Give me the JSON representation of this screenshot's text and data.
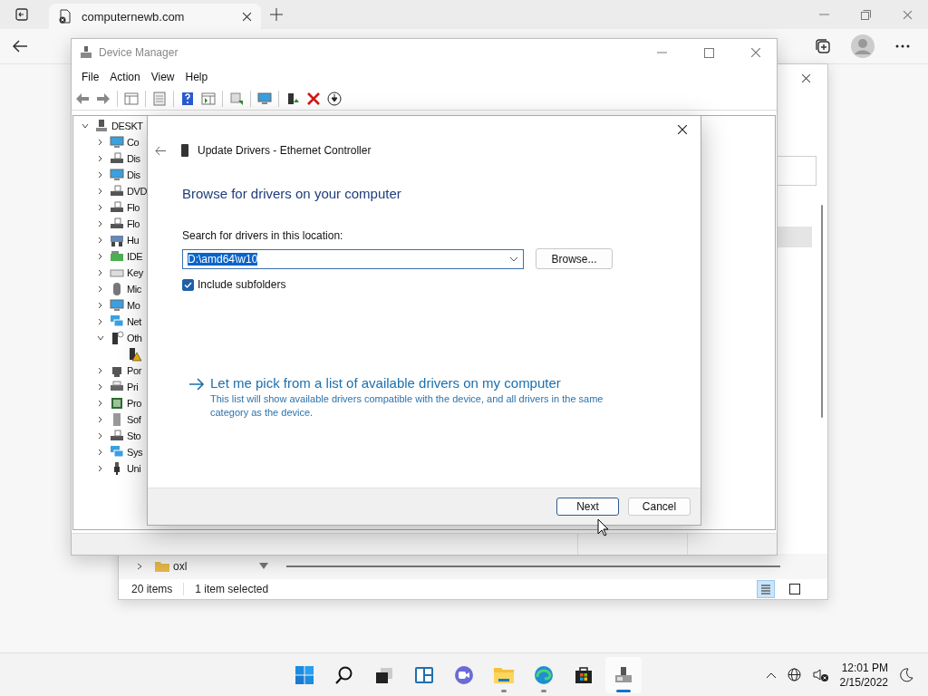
{
  "browser": {
    "tab": {
      "title": "computernewb.com"
    }
  },
  "background_window": {
    "nav_item": {
      "label": "oxl",
      "expanded": false
    },
    "status_bar": {
      "item_count": "20 items",
      "selection": "1 item selected"
    },
    "views": [
      {
        "kind": "details",
        "selected": true
      },
      {
        "kind": "tiles",
        "selected": false
      }
    ]
  },
  "device_manager": {
    "title": "Device Manager",
    "menu": [
      "File",
      "Action",
      "View",
      "Help"
    ],
    "tree": {
      "label": "DESKT",
      "expanded": true,
      "children": [
        {
          "label": "Co",
          "expanded": false
        },
        {
          "label": "Dis",
          "expanded": false
        },
        {
          "label": "Dis",
          "expanded": false
        },
        {
          "label": "DVD",
          "expanded": false
        },
        {
          "label": "Flo",
          "expanded": false
        },
        {
          "label": "Flo",
          "expanded": false
        },
        {
          "label": "Hu",
          "expanded": false
        },
        {
          "label": "IDE",
          "expanded": false
        },
        {
          "label": "Key",
          "expanded": false
        },
        {
          "label": "Mic",
          "expanded": false
        },
        {
          "label": "Mo",
          "expanded": false
        },
        {
          "label": "Net",
          "expanded": false
        },
        {
          "label": "Oth",
          "expanded": true,
          "children": [
            {
              "warning": true
            }
          ]
        },
        {
          "label": "Por",
          "expanded": false
        },
        {
          "label": "Pri",
          "expanded": false
        },
        {
          "label": "Pro",
          "expanded": false
        },
        {
          "label": "Sof",
          "expanded": false
        },
        {
          "label": "Sto",
          "expanded": false
        },
        {
          "label": "Sys",
          "expanded": false
        },
        {
          "label": "Uni",
          "expanded": false
        }
      ]
    }
  },
  "dialog": {
    "title": "Update Drivers - Ethernet Controller",
    "heading": "Browse for drivers on your computer",
    "location_label": "Search for drivers in this location:",
    "location": {
      "value": "D:\\amd64\\w10",
      "selected": true
    },
    "browse_button": "Browse...",
    "include_subfolders": {
      "label": "Include subfolders",
      "checked": true
    },
    "pick_link": {
      "title": "Let me pick from a list of available drivers on my computer",
      "description": "This list will show available drivers compatible with the device, and all drivers in the same category as the device."
    },
    "buttons": [
      {
        "label": "Next",
        "focused": true
      },
      {
        "label": "Cancel",
        "focused": false
      }
    ]
  },
  "taskbar": {
    "apps": [
      {
        "kind": "start",
        "running": false,
        "active": false
      },
      {
        "kind": "search",
        "running": false,
        "active": false
      },
      {
        "kind": "taskview",
        "running": false,
        "active": false
      },
      {
        "kind": "widgets",
        "running": false,
        "active": false
      },
      {
        "kind": "chat",
        "running": false,
        "active": false
      },
      {
        "kind": "folder",
        "running": true,
        "active": false
      },
      {
        "kind": "browser",
        "running": true,
        "active": false
      },
      {
        "kind": "store",
        "running": false,
        "active": false
      },
      {
        "kind": "devmgr",
        "running": true,
        "active": true
      }
    ],
    "clock": {
      "time": "12:01 PM",
      "date": "2/15/2022"
    }
  }
}
